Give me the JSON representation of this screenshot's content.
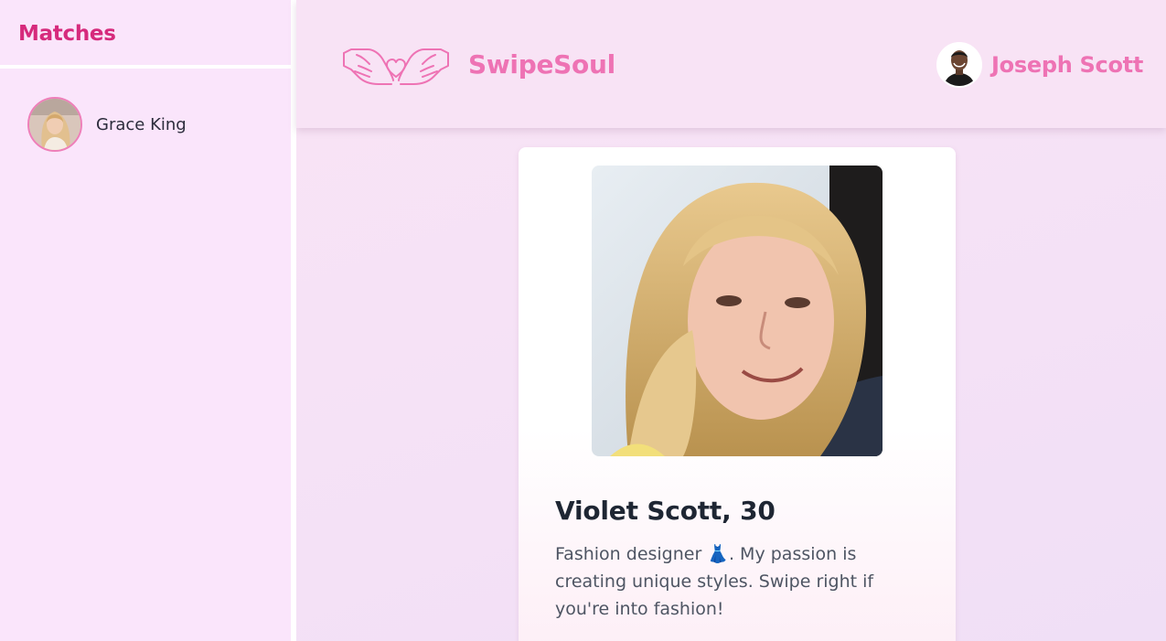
{
  "sidebar": {
    "title": "Matches",
    "matches": [
      {
        "name": "Grace King"
      }
    ]
  },
  "header": {
    "brand": "SwipeSoul",
    "user_name": "Joseph Scott"
  },
  "profile": {
    "name_age": "Violet Scott, 30",
    "bio": "Fashion designer 👗. My passion is creating unique styles. Swipe right if you're into fashion!"
  },
  "colors": {
    "accent_pink": "#ee73b4",
    "title_pink": "#d62a7c",
    "sidebar_bg": "#fae5fb",
    "main_bg": "#f5e4f7"
  },
  "icons": {
    "logo": "heart-hands-icon"
  }
}
